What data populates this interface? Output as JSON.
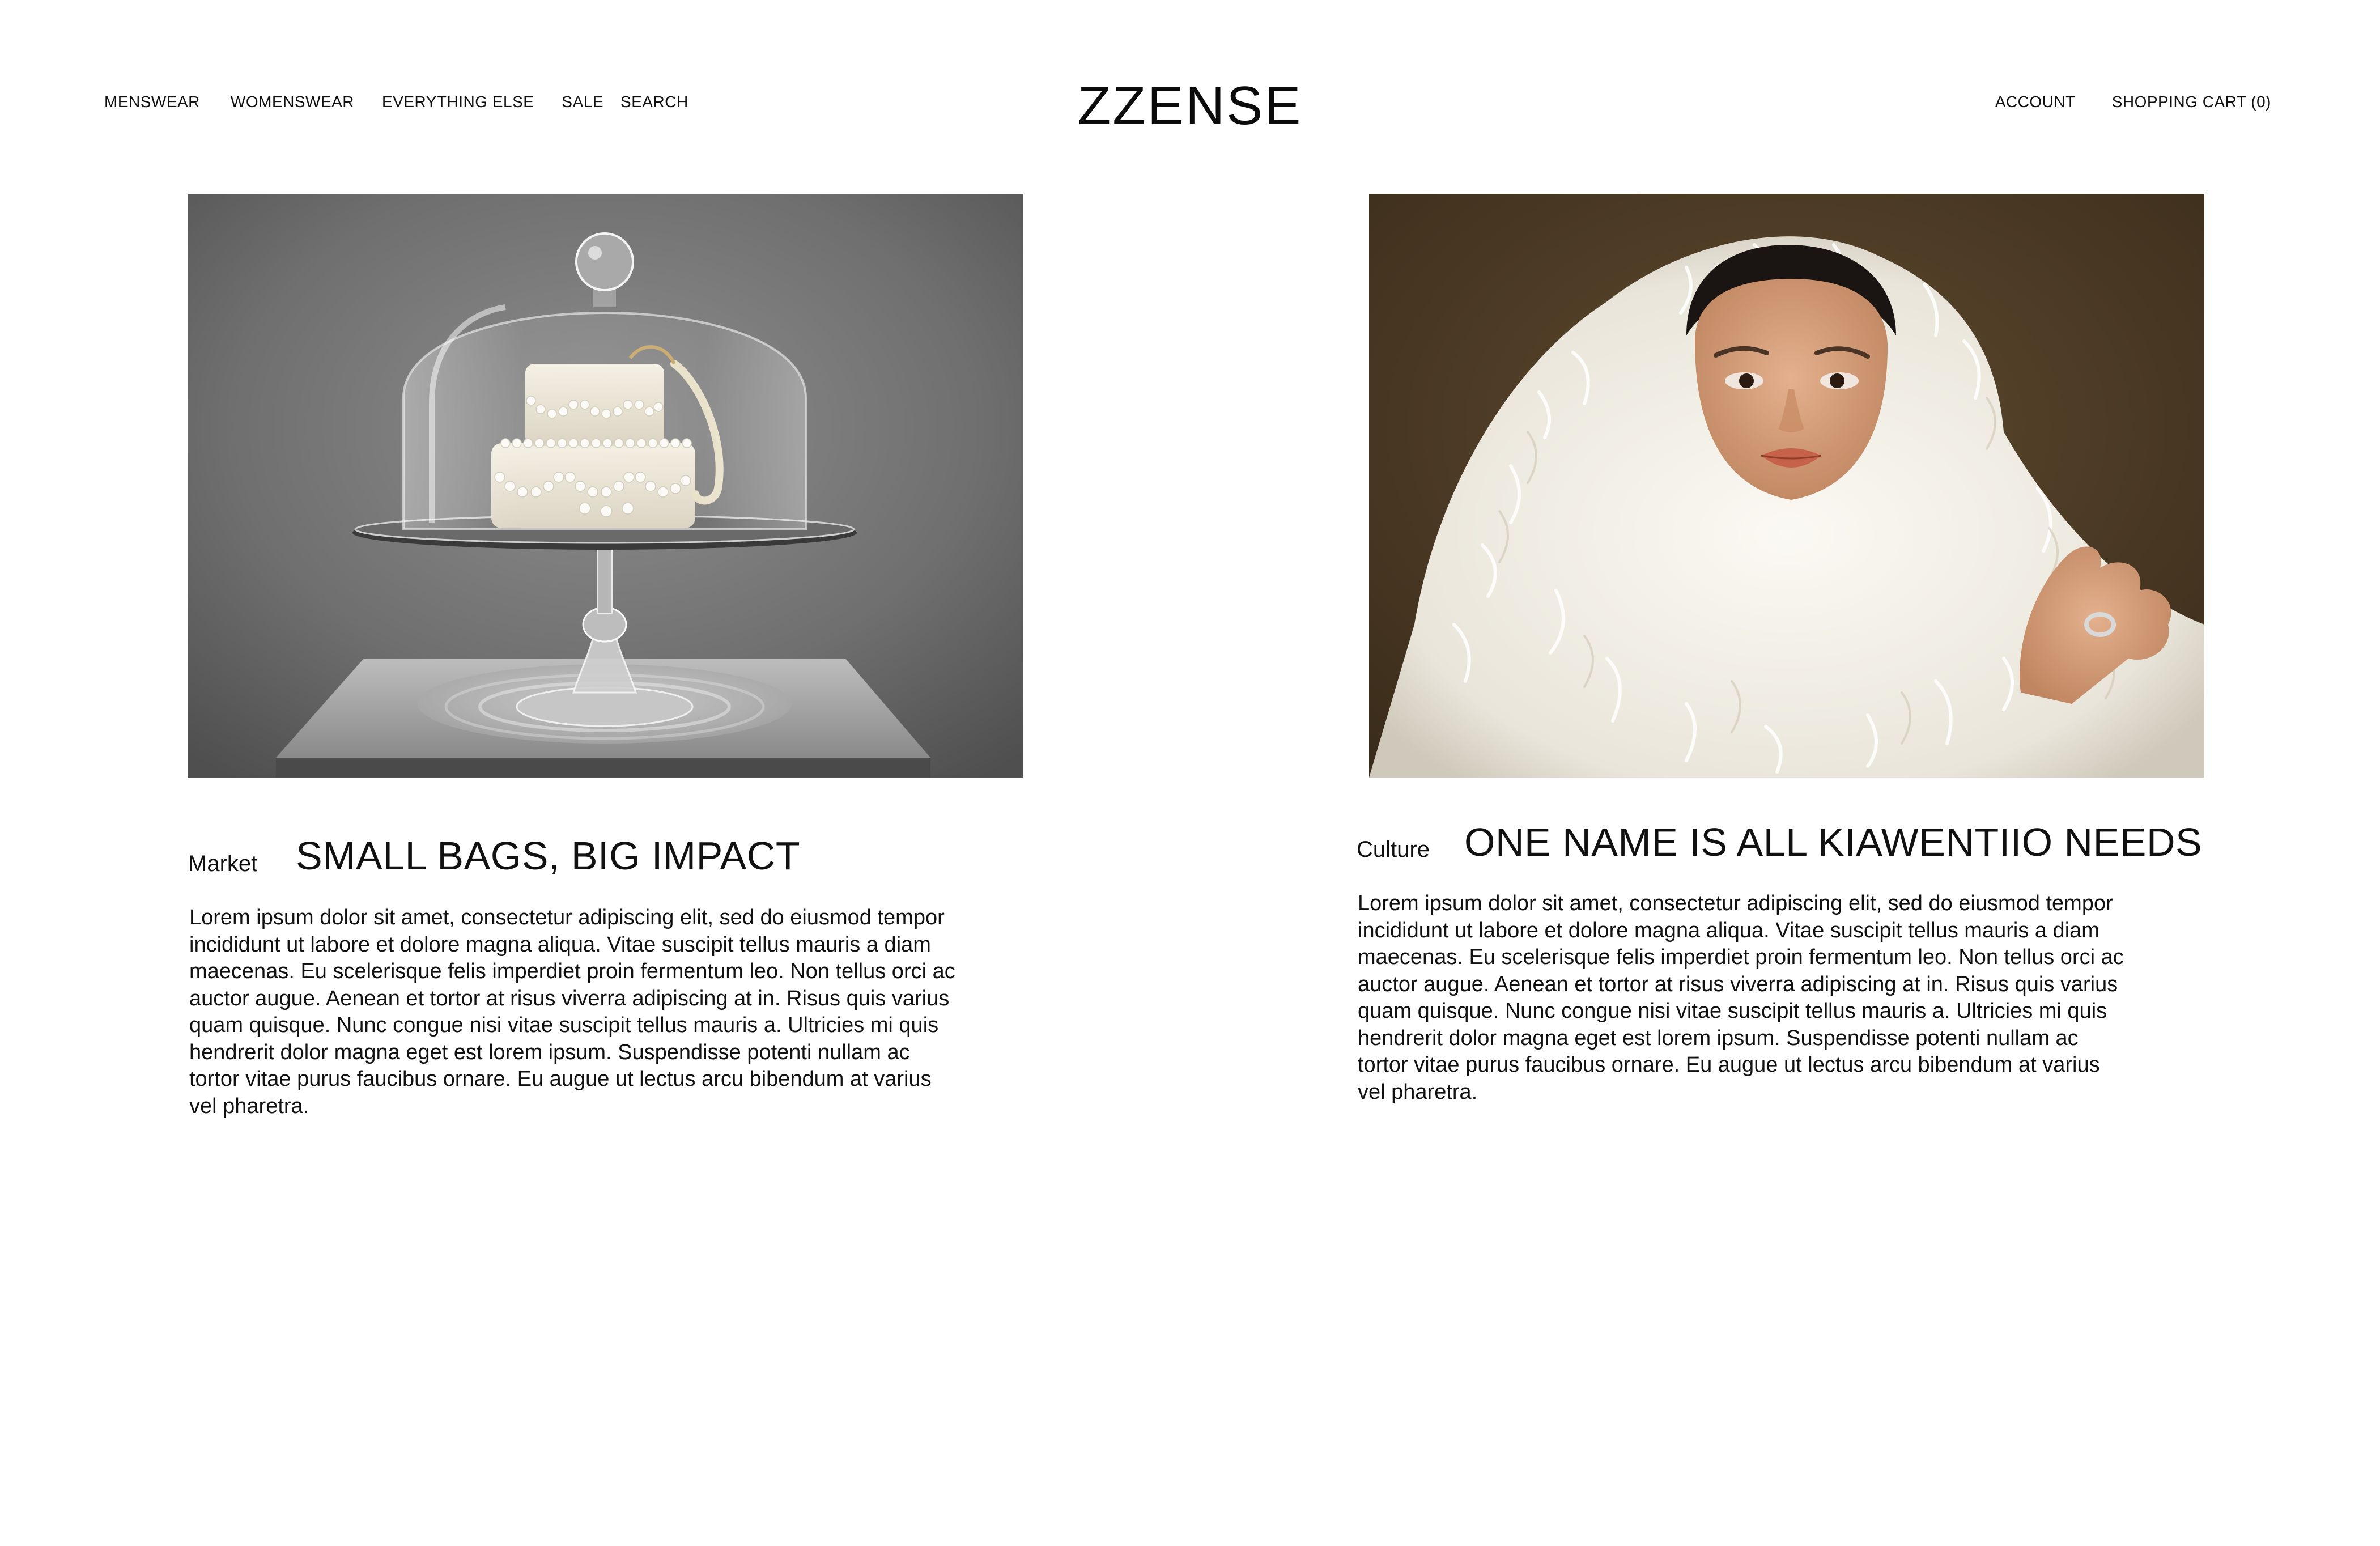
{
  "header": {
    "logo": "ZZENSE",
    "nav": {
      "menswear": "MENSWEAR",
      "womenswear": "WOMENSWEAR",
      "everything_else": "EVERYTHING ELSE",
      "sale": "SALE",
      "search": "SEARCH"
    },
    "account": "ACCOUNT",
    "cart": {
      "label": "SHOPPING CART",
      "count": "(0)"
    }
  },
  "articles": [
    {
      "category": "Market",
      "title": "SMALL BAGS, BIG IMPACT",
      "body": "Lorem ipsum dolor sit amet, consectetur adipiscing elit, sed do eiusmod tempor incididunt ut labore et dolore magna aliqua. Vitae suscipit tellus mauris a diam maecenas. Eu scelerisque felis imperdiet proin fermentum leo. Non tellus orci ac auctor augue. Aenean et tortor at risus viverra adipiscing at in. Risus quis varius quam quisque. Nunc congue nisi vitae suscipit tellus mauris a. Ultricies mi quis hendrerit dolor magna eget est lorem ipsum. Suspendisse potenti nullam ac tortor vitae purus faucibus ornare. Eu augue ut lectus arcu bibendum at varius vel pharetra."
    },
    {
      "category": "Culture",
      "title": "ONE NAME IS ALL KIAWENTIIO NEEDS",
      "body": "Lorem ipsum dolor sit amet, consectetur adipiscing elit, sed do eiusmod tempor incididunt ut labore et dolore magna aliqua. Vitae suscipit tellus mauris a diam maecenas. Eu scelerisque felis imperdiet proin fermentum leo. Non tellus orci ac auctor augue. Aenean et tortor at risus viverra adipiscing at in. Risus quis varius quam quisque. Nunc congue nisi vitae suscipit tellus mauris a. Ultricies mi quis hendrerit dolor magna eget est lorem ipsum. Suspendisse potenti nullam ac tortor vitae purus faucibus ornare. Eu augue ut lectus arcu bibendum at varius vel pharetra."
    }
  ]
}
